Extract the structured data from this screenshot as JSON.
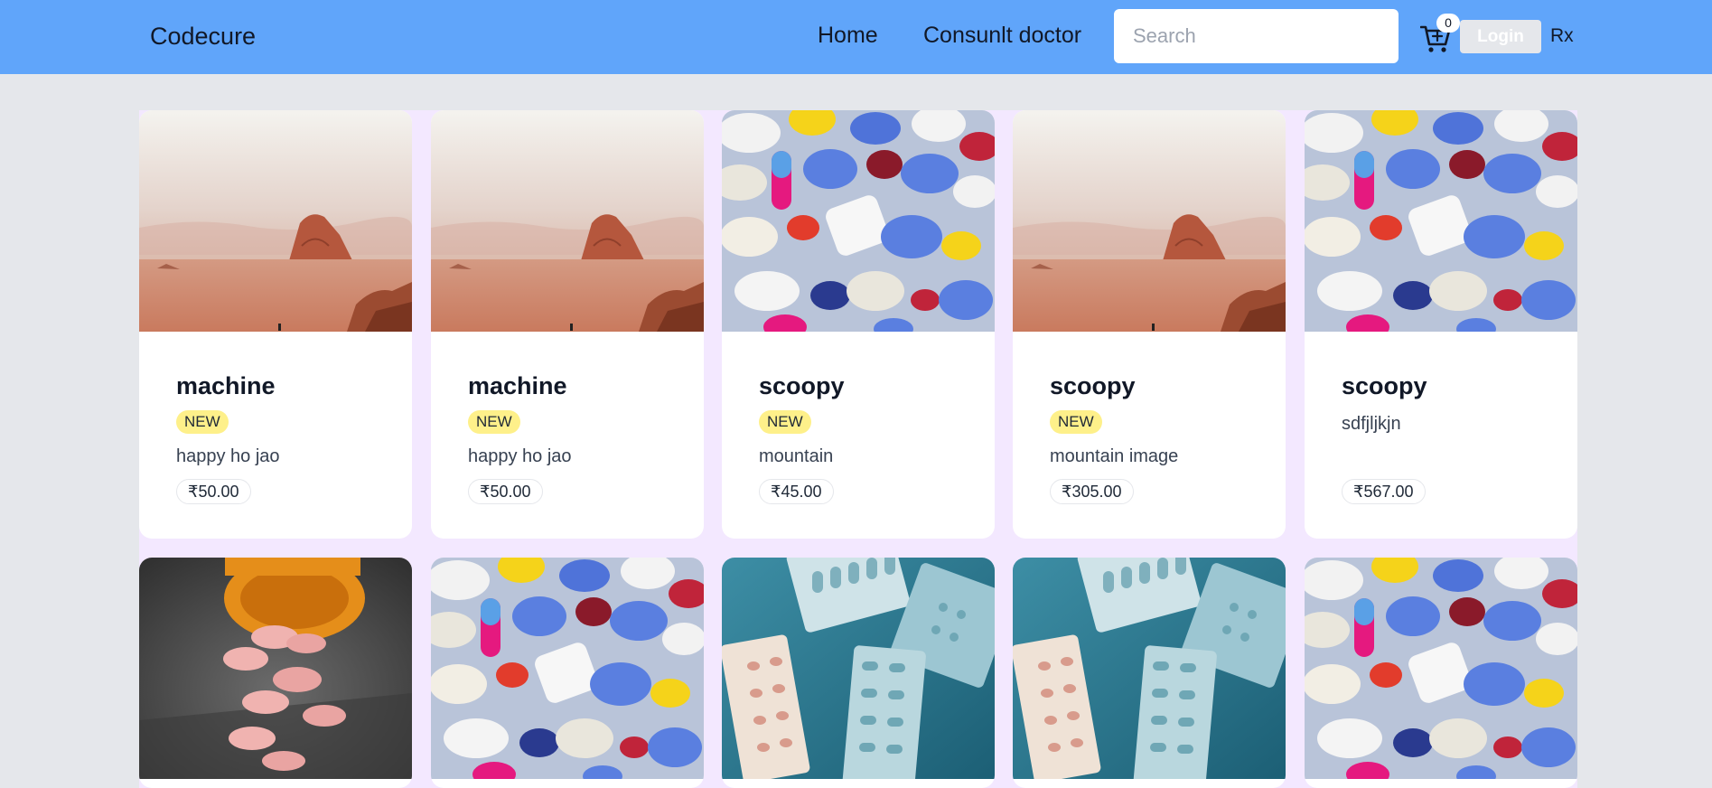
{
  "navbar": {
    "brand": "Codecure",
    "links": [
      "Home",
      "Consunlt doctor"
    ],
    "search_placeholder": "Search",
    "search_value": "",
    "cart_count": "0",
    "login_label": "Login",
    "rx_label": "Rx"
  },
  "products": [
    {
      "title": "machine",
      "badge": "NEW",
      "description": "happy ho jao",
      "price": "₹50.00",
      "image": "desert"
    },
    {
      "title": "machine",
      "badge": "NEW",
      "description": "happy ho jao",
      "price": "₹50.00",
      "image": "desert"
    },
    {
      "title": "scoopy",
      "badge": "NEW",
      "description": "mountain",
      "price": "₹45.00",
      "image": "pills"
    },
    {
      "title": "scoopy",
      "badge": "NEW",
      "description": "mountain image",
      "price": "₹305.00",
      "image": "desert"
    },
    {
      "title": "scoopy",
      "badge": "",
      "description": "sdfjljkjn",
      "price": "₹567.00",
      "image": "pills"
    },
    {
      "image": "bottle"
    },
    {
      "image": "pills"
    },
    {
      "image": "blister"
    },
    {
      "image": "blister"
    },
    {
      "image": "pills"
    }
  ],
  "colors": {
    "navbar": "#60a5fa",
    "page_background": "#e5e7eb",
    "grid_background": "#f3e8ff",
    "badge": "#fef08a"
  },
  "icons": {
    "cart": "cart-icon"
  }
}
